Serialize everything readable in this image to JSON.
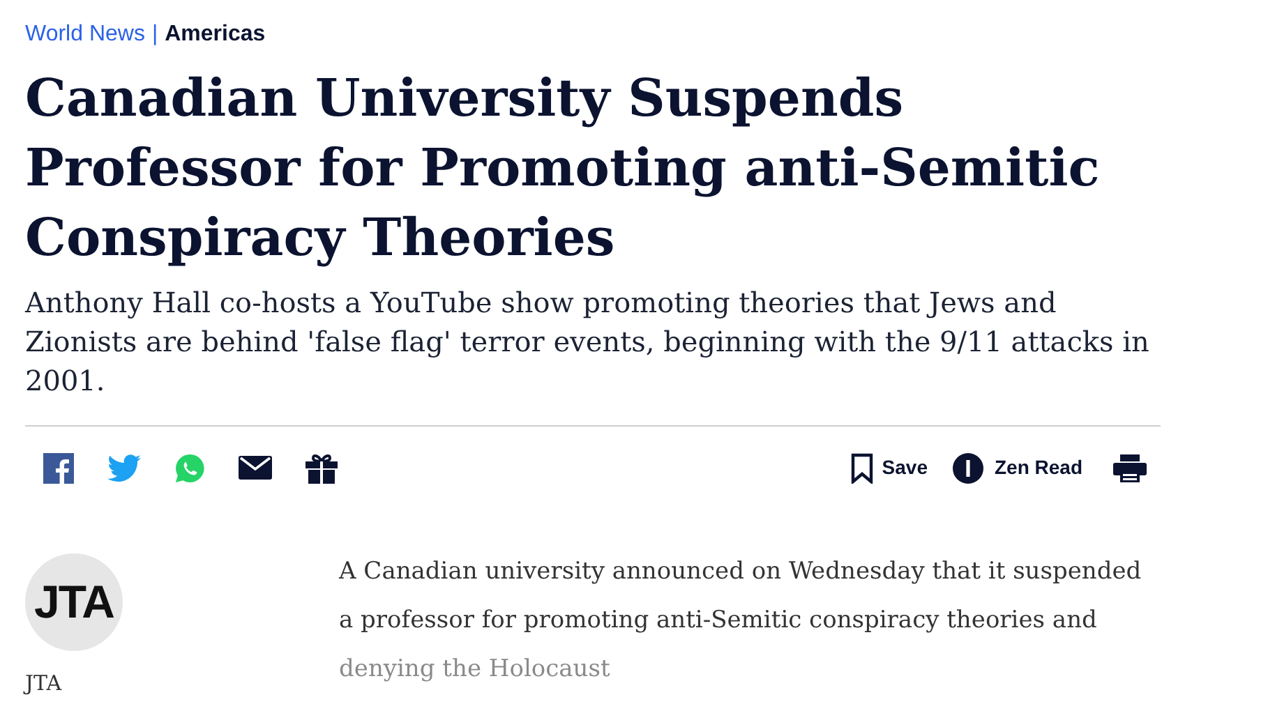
{
  "breadcrumb": {
    "section": "World News",
    "separator": "|",
    "subsection": "Americas"
  },
  "headline": "Canadian University Suspends Professor for Promoting anti-Semitic Conspiracy Theories",
  "subheadline": "Anthony Hall co-hosts a YouTube show promoting theories that Jews and Zionists are behind 'false flag' terror events, beginning with the 9/11 attacks in 2001.",
  "toolbar": {
    "share": [
      {
        "kind": "facebook"
      },
      {
        "kind": "twitter"
      },
      {
        "kind": "whatsapp"
      },
      {
        "kind": "email"
      },
      {
        "kind": "gift"
      }
    ],
    "save": "Save",
    "zen_read": "Zen Read"
  },
  "author": {
    "logo": "JTA",
    "name": "JTA"
  },
  "body": {
    "text": "A Canadian university announced on Wednesday that it suspended a professor for promoting anti-Semitic conspiracy theories and",
    "faded": "denying the Holocaust"
  }
}
